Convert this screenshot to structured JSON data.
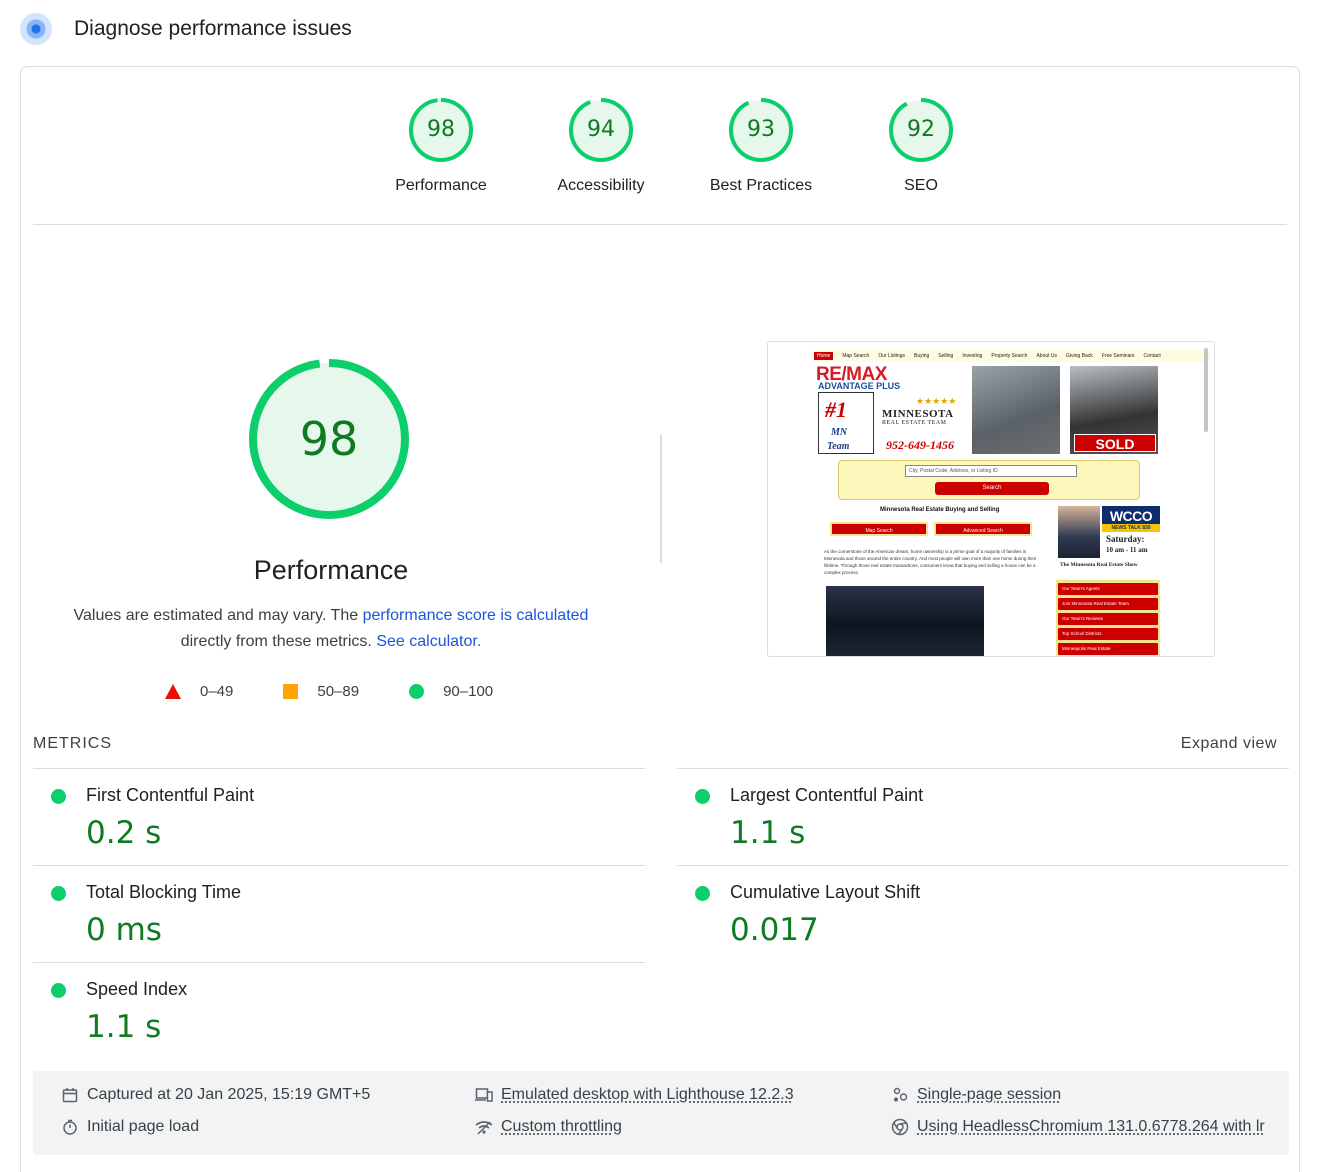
{
  "header": {
    "title": "Diagnose performance issues",
    "icon": "lighthouse-icon"
  },
  "gauges": [
    {
      "label": "Performance",
      "score": "98",
      "value": 98
    },
    {
      "label": "Accessibility",
      "score": "94",
      "value": 94
    },
    {
      "label": "Best Practices",
      "score": "93",
      "value": 93
    },
    {
      "label": "SEO",
      "score": "92",
      "value": 92
    }
  ],
  "performance": {
    "score": "98",
    "value": 98,
    "title": "Performance",
    "desc_prefix": "Values are estimated and may vary. The ",
    "desc_link1": "performance score is calculated",
    "desc_middle": "directly from these metrics. ",
    "desc_link2": "See calculator."
  },
  "legend": [
    {
      "shape": "triangle",
      "range": "0–49",
      "color": "#eb0f00"
    },
    {
      "shape": "square",
      "range": "50–89",
      "color": "#ffa400"
    },
    {
      "shape": "circle",
      "range": "90–100",
      "color": "#0cce6b"
    }
  ],
  "screenshot": {
    "nav": [
      "Home",
      "Map Search",
      "Our Listings",
      "Buying",
      "Selling",
      "Investing",
      "Property Search",
      "About Us",
      "Giving Back",
      "Free Seminars",
      "Contact"
    ],
    "brand": "RE/MAX",
    "brand_sub": "ADVANTAGE PLUS",
    "mn_number": "#1",
    "mn_line1": "MN",
    "mn_line2": "Team",
    "stars": "★★★★★",
    "team_name": "MINNESOTA",
    "team_sub": "REAL ESTATE TEAM",
    "phone": "952-649-1456",
    "sold": "SOLD",
    "search_placeholder": "City, Postal Code, Address, or Listing ID",
    "search_button": "Search",
    "heading": "Minnesota Real Estate Buying and Selling",
    "btn_map": "Map Search",
    "btn_advanced": "Advanced Search",
    "paragraph": "As the cornerstone of the American dream, home ownership is a prime goal of a majority of families in Minnesota and those around the entire country. And most people will own more than one home during their lifetime. Through those real estate transactions, consumers know that buying and selling a house can be a complex process.",
    "wcco": "WCCO",
    "wcco_sub": "NEWS TALK 830",
    "saturday": "Saturday:",
    "saturday_time": "10 am - 11 am",
    "show": "The Minnesota Real Estate Show",
    "side_links": [
      "Our Team's Agents",
      "Join Minnesota Real Estate Team",
      "Our Team's Reviews",
      "Top School Districts",
      "Minneapolis Real Estate"
    ]
  },
  "metrics": {
    "title": "METRICS",
    "expand_label": "Expand view",
    "items": [
      {
        "name": "First Contentful Paint",
        "value": "0.2 s"
      },
      {
        "name": "Largest Contentful Paint",
        "value": "1.1 s"
      },
      {
        "name": "Total Blocking Time",
        "value": "0 ms"
      },
      {
        "name": "Cumulative Layout Shift",
        "value": "0.017"
      },
      {
        "name": "Speed Index",
        "value": "1.1 s"
      }
    ]
  },
  "footer": {
    "captured": "Captured at 20 Jan 2025, 15:19 GMT+5",
    "load": "Initial page load",
    "emulated": "Emulated desktop with Lighthouse 12.2.3",
    "throttling": "Custom throttling",
    "session": "Single-page session",
    "browser": "Using HeadlessChromium 131.0.6778.264 with lr"
  },
  "colors": {
    "pass": "#0cce6b",
    "pass_text": "#0f7b21",
    "pass_fill": "#e6f7ec",
    "link": "#1a56db"
  }
}
